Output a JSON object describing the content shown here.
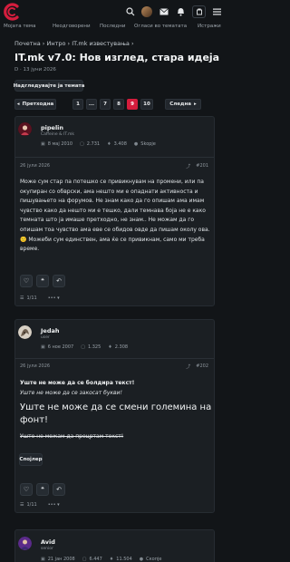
{
  "nav": {
    "items": [
      "Мојата тема",
      "Неодговорени",
      "Последни",
      "Огласи во тематата",
      "Истражи"
    ]
  },
  "breadcrumbs": "Почетна › Интро › IT.mk известувања ›",
  "thread": {
    "title": "IT.mk v7.0: Нов изглед, стара идеја",
    "meta": "D · 13 јуни 2026",
    "watch_label": "Надгледувајте ја темата"
  },
  "pagination": {
    "prev": "Претходна",
    "pages": [
      "1",
      "...",
      "7",
      "8",
      "9",
      "10"
    ],
    "active": "9",
    "next": "Следна"
  },
  "posts": [
    {
      "user": "pipelin",
      "user_title": "Caffeine & IT.mk",
      "joined": "8 мај 2010",
      "messages": "2.731",
      "reactions": "3.408",
      "location": "Skopje",
      "date": "26 јули 2026",
      "id": "#201",
      "body": "Може сум стар па потешко се привикнувам на промени, или па окупиран со обврски, ама нешто ми е опаднати активноста и пишувањето на форумов. Не знам како да го опишам ама имам чувство како да нешто ми е тешко, дали темнава боја не е како темната што ја имаше претходно, не знам.. Не можам да го опишам тоа чувство ама еве се обидов овде да пишам околу ова. 🙁 Можеби сум единствен, ама ќе се привикнам, само ми треба време.",
      "reply_count": "1/11"
    },
    {
      "user": "Jedah",
      "user_title": "user",
      "joined": "6 ное 2007",
      "messages": "1.325",
      "reactions": "2.308",
      "date": "26 јули 2026",
      "id": "#202",
      "line1": "Уште не може да се болдира текст!",
      "line2": "Уште не може да се закосат букви!",
      "big": "Уште не може да се смени големина на фонт!",
      "line3": "Уште не можам да прецртам текст!",
      "spoiler_label": "Спојлер",
      "reply_count": "1/11"
    },
    {
      "user": "Avid",
      "user_title": "senior",
      "joined": "21 јан 2008",
      "messages": "6.447",
      "reactions": "11.504",
      "location": "Скопје"
    }
  ],
  "colors": {
    "accent": "#d51d3d",
    "bg": "#121518",
    "card": "#1b1f23"
  }
}
